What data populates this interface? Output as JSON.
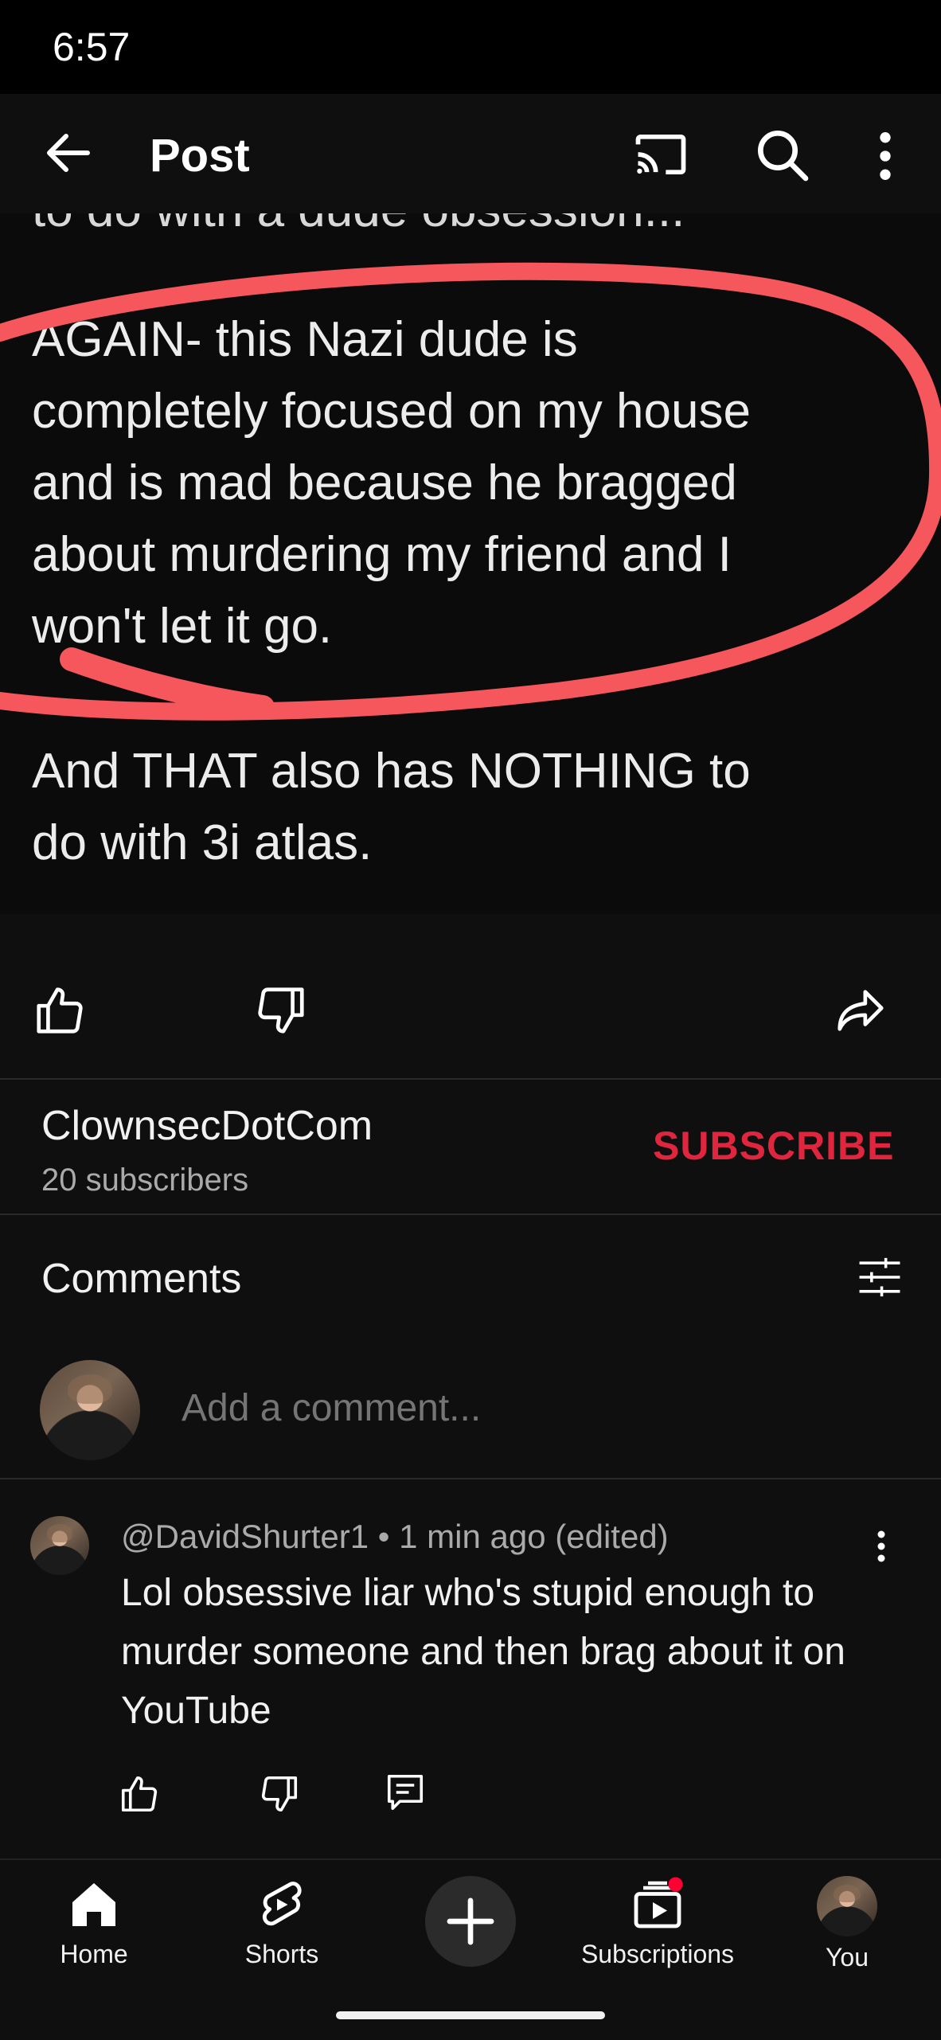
{
  "status_bar": {
    "time": "6:57"
  },
  "app_bar": {
    "title": "Post",
    "icons": [
      "back-arrow-icon",
      "cast-icon",
      "search-icon",
      "more-vert-icon"
    ]
  },
  "post": {
    "cut_off_line": "to do with a dude  obsession...",
    "paragraph_1": "AGAIN- this Nazi dude is\ncompletely focused on my house\nand is mad because he bragged\nabout murdering my friend and I\nwon't let it go.",
    "paragraph_2": "And THAT also has NOTHING to\ndo with 3i atlas.",
    "annotation_color": "#f5575c"
  },
  "post_actions": {
    "icons": [
      "thumb-up-icon",
      "thumb-down-icon",
      "share-icon"
    ]
  },
  "channel": {
    "name": "ClownsecDotCom",
    "subscribers": "20 subscribers",
    "subscribe_label": "SUBSCRIBE",
    "subscribe_color": "#e0263f"
  },
  "comments": {
    "title": "Comments",
    "add_placeholder": "Add a comment...",
    "items": [
      {
        "author_meta": "@DavidShurter1 • 1 min ago (edited)",
        "text": "Lol obsessive liar who's stupid enough to murder someone and then brag about it on YouTube"
      }
    ]
  },
  "bottom_nav": {
    "items": [
      {
        "label": "Home",
        "icon": "home-icon"
      },
      {
        "label": "Shorts",
        "icon": "shorts-icon"
      },
      {
        "label": "",
        "icon": "plus-icon"
      },
      {
        "label": "Subscriptions",
        "icon": "subscriptions-icon"
      },
      {
        "label": "You",
        "icon": "avatar"
      }
    ],
    "notification_color": "#ff0033"
  }
}
